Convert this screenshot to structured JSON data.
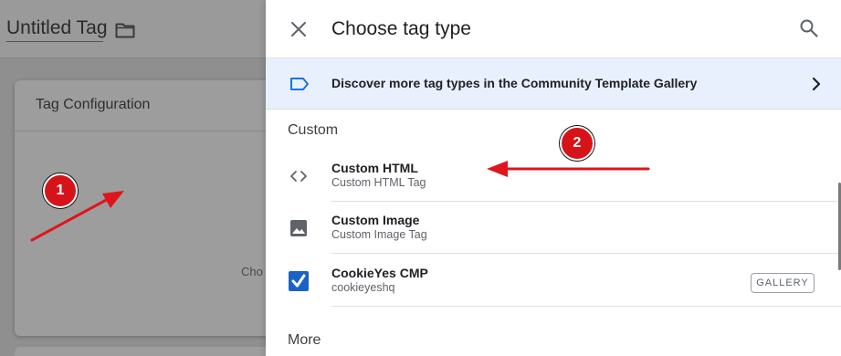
{
  "background": {
    "page_title": "Untitled Tag",
    "card_title": "Tag Configuration",
    "card_hint_partial": "Cho"
  },
  "panel": {
    "title": "Choose tag type",
    "discover_text": "Discover more tag types in the Community Template Gallery",
    "sections": {
      "custom": "Custom",
      "more": "More"
    },
    "items": [
      {
        "name": "Custom HTML",
        "subtitle": "Custom HTML Tag",
        "icon": "code-icon"
      },
      {
        "name": "Custom Image",
        "subtitle": "Custom Image Tag",
        "icon": "image-icon"
      },
      {
        "name": "CookieYes CMP",
        "subtitle": "cookieyeshq",
        "icon": "checkbox-logo-icon",
        "badge": "GALLERY"
      }
    ]
  },
  "annotations": {
    "badge_1": "1",
    "badge_2": "2"
  },
  "colors": {
    "accent_blue": "#1a73e8",
    "annotation_red": "#d7131a",
    "discover_bg": "#e8f0fe"
  }
}
